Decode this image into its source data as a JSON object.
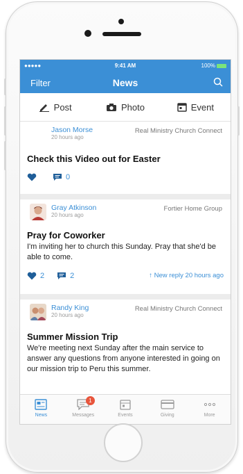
{
  "status_bar": {
    "carrier": "●●●●● ",
    "time": "9:41 AM",
    "battery": "100%"
  },
  "nav": {
    "filter": "Filter",
    "title": "News"
  },
  "actions": [
    {
      "label": "Post",
      "icon": "pencil-icon"
    },
    {
      "label": "Photo",
      "icon": "camera-icon"
    },
    {
      "label": "Event",
      "icon": "calendar-icon"
    }
  ],
  "posts": [
    {
      "author": "Jason Morse",
      "time": "20 hours ago",
      "group": "Real Ministry Church Connect",
      "title": "Check this Video out for Easter",
      "body": "",
      "likes": "",
      "comments": "0",
      "reply": ""
    },
    {
      "author": "Gray Atkinson",
      "time": "20 hours ago",
      "group": "Fortier Home Group",
      "title": "Pray for Coworker",
      "body": "I'm inviting her to church this Sunday. Pray that she'd be able to come.",
      "likes": "2",
      "comments": "2",
      "reply": "New reply 20 hours ago"
    },
    {
      "author": "Randy King",
      "time": "20 hours ago",
      "group": "Real Ministry Church Connect",
      "title": "Summer Mission Trip",
      "body": "We're meeting next Sunday after the main service to answer any questions from anyone interested in going on our mission trip to Peru this summer.",
      "likes": "",
      "comments": "",
      "reply": ""
    }
  ],
  "tabs": [
    {
      "label": "News",
      "icon": "news-icon",
      "active": true
    },
    {
      "label": "Messages",
      "icon": "messages-icon",
      "badge": "1"
    },
    {
      "label": "Events",
      "icon": "events-icon"
    },
    {
      "label": "Giving",
      "icon": "giving-icon"
    },
    {
      "label": "More",
      "icon": "more-icon"
    }
  ],
  "colors": {
    "accent": "#3b8fd6",
    "badge": "#e8553c"
  }
}
